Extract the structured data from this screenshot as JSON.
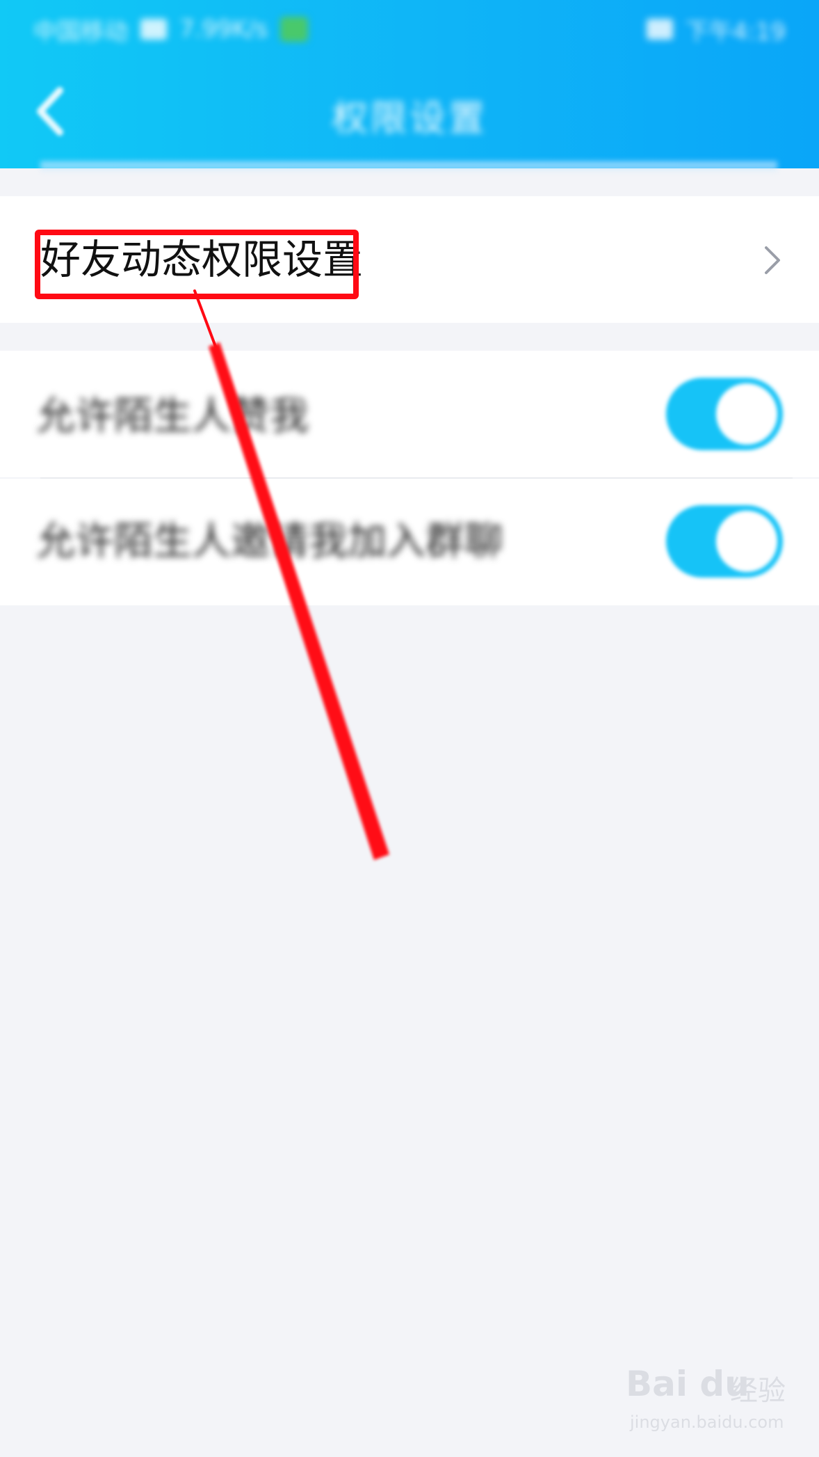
{
  "status_bar": {
    "carrier": "中国移动",
    "speed": "7.99K/s",
    "time": "下午4:19"
  },
  "header": {
    "title": "权限设置",
    "back_icon": "chevron-left-icon"
  },
  "rows": {
    "friend_dynamic": {
      "label": "好友动态权限设置",
      "chevron_icon": "chevron-right-icon"
    },
    "allow_stranger_like": {
      "label": "允许陌生人赞我",
      "toggle_on": true
    },
    "allow_stranger_invite": {
      "label": "允许陌生人邀请我加入群聊",
      "toggle_on": true
    }
  },
  "annotation": {
    "color": "#ff0a14"
  },
  "watermark": {
    "logo": "Bai du",
    "cn": "经验",
    "url": "jingyan.baidu.com"
  },
  "colors": {
    "header_start": "#11c9f6",
    "header_end": "#0aa6f8",
    "toggle": "#16c3f7",
    "background": "#f3f4f8"
  }
}
